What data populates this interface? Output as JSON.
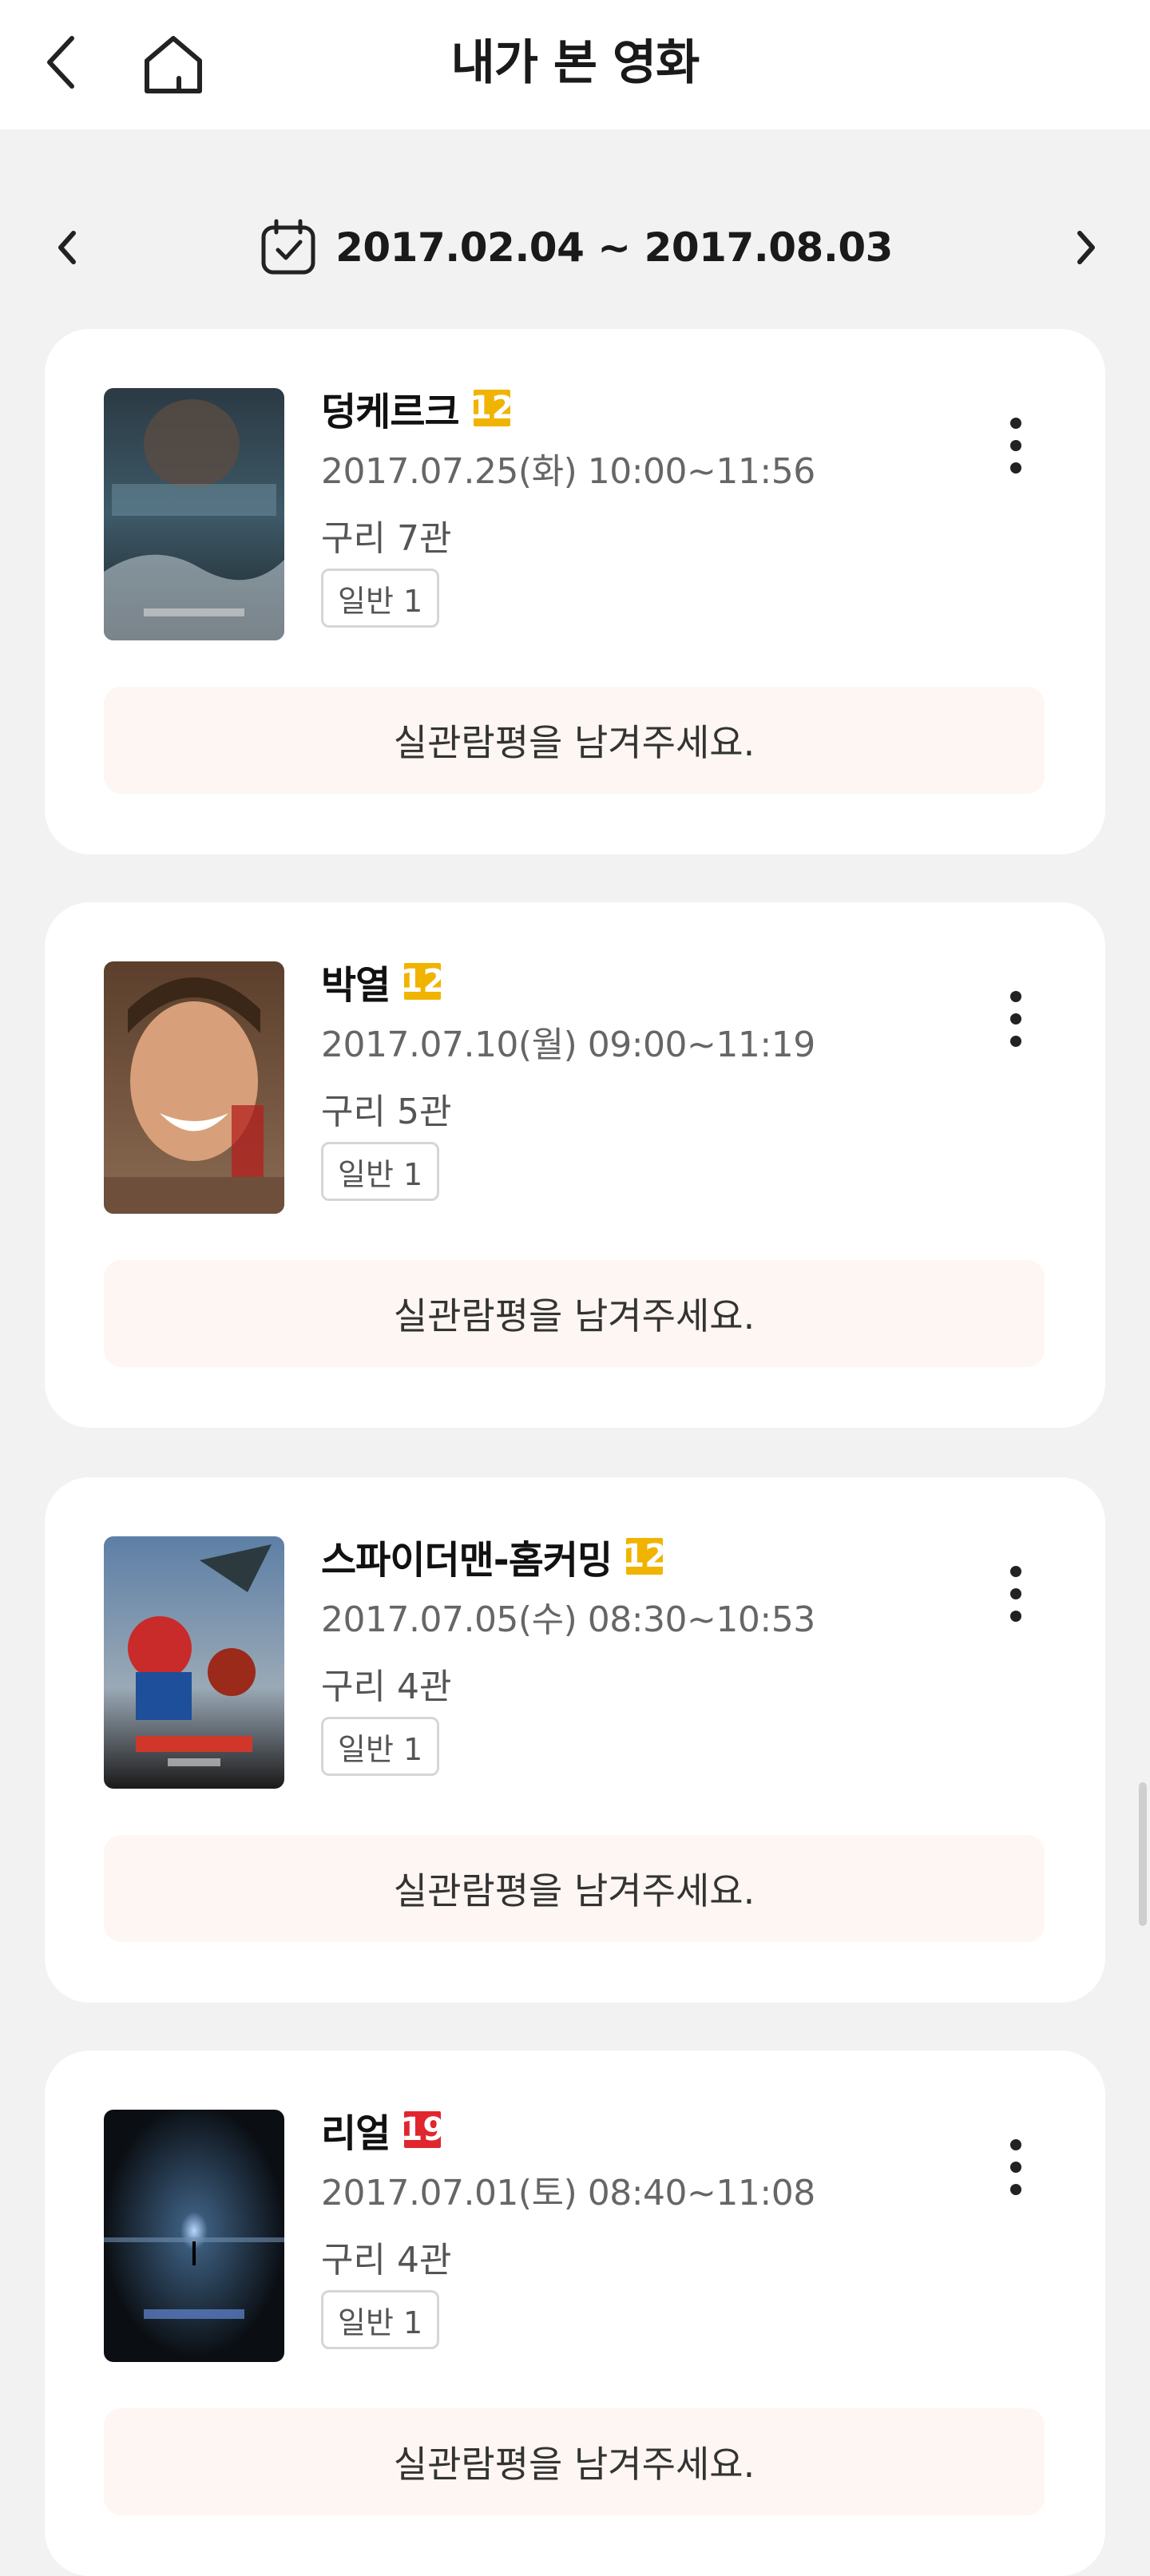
{
  "header": {
    "title": "내가 본 영화"
  },
  "date_range": {
    "label": "2017.02.04 ~ 2017.08.03"
  },
  "colors": {
    "rating_12": "#f0b400",
    "rating_19": "#e0262e",
    "review_bg": "#fdf6f2"
  },
  "icons": {
    "back": "chevron-left-icon",
    "home": "home-icon",
    "calendar": "calendar-check-icon",
    "prev": "chevron-left-icon",
    "next": "chevron-right-icon",
    "more": "more-vertical-icon"
  },
  "movies": [
    {
      "title": "덩케르크",
      "rating": "12",
      "showtime": "2017.07.25(화) 10:00~11:56",
      "theater": "구리 7관",
      "seat": "일반 1",
      "review": "실관람평을 남겨주세요."
    },
    {
      "title": "박열",
      "rating": "12",
      "showtime": "2017.07.10(월) 09:00~11:19",
      "theater": "구리 5관",
      "seat": "일반 1",
      "review": "실관람평을 남겨주세요."
    },
    {
      "title": "스파이더맨-홈커밍",
      "rating": "12",
      "showtime": "2017.07.05(수) 08:30~10:53",
      "theater": "구리 4관",
      "seat": "일반 1",
      "review": "실관람평을 남겨주세요."
    },
    {
      "title": "리얼",
      "rating": "19",
      "showtime": "2017.07.01(토) 08:40~11:08",
      "theater": "구리 4관",
      "seat": "일반 1",
      "review": "실관람평을 남겨주세요."
    }
  ]
}
